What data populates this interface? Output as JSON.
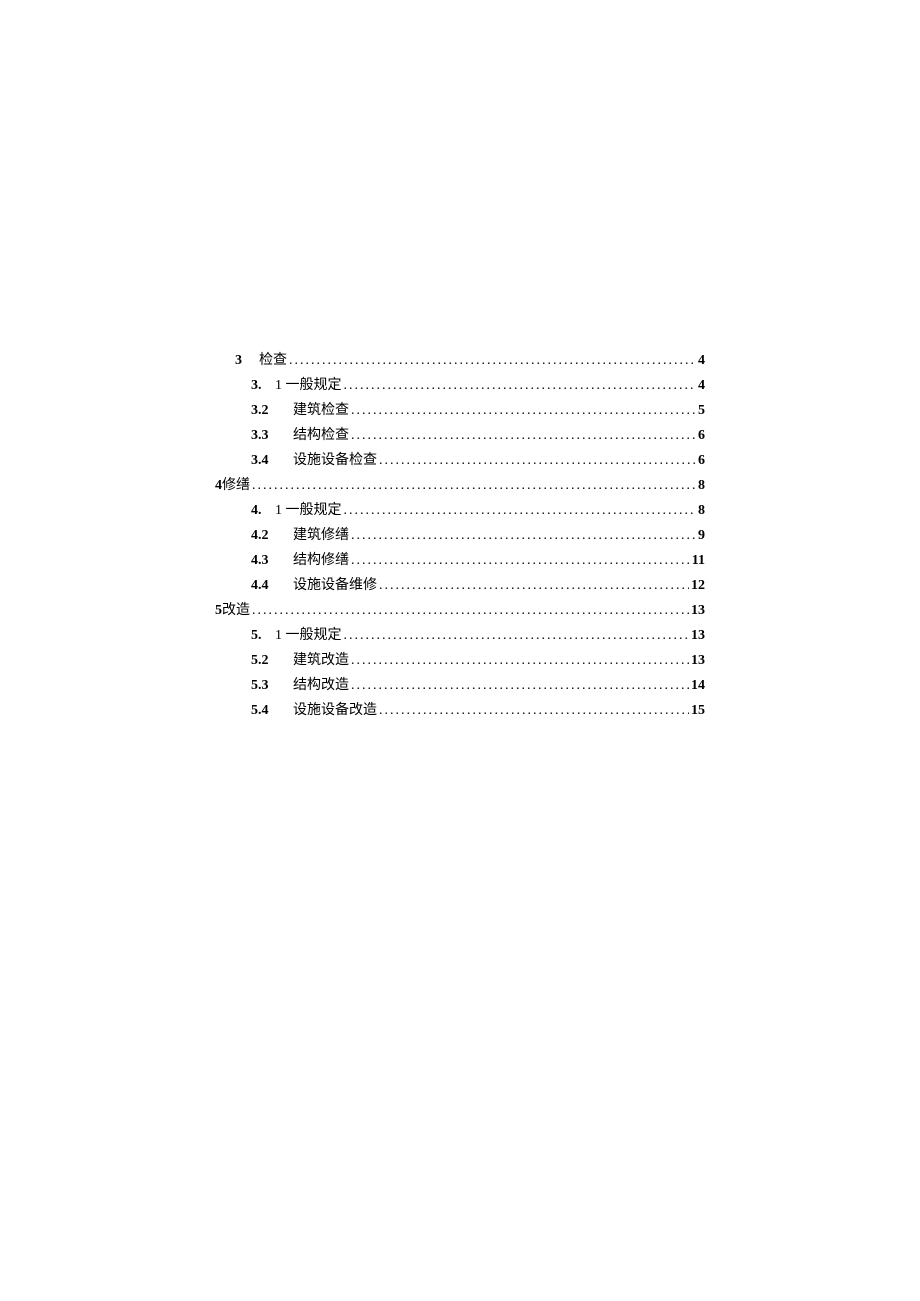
{
  "toc": [
    {
      "level": 1,
      "num": "3",
      "title": "检查",
      "page": "4",
      "numClass": "chapter-num",
      "titleClass": "toc-title"
    },
    {
      "level": 2,
      "num": "3.",
      "title": "1 一般规定",
      "page": "4",
      "numClass": "chapter-num",
      "titleClass": "toc-title"
    },
    {
      "level": 2,
      "num": "3.2",
      "title": "建筑检查",
      "page": "5",
      "numClass": "sub-num",
      "titleClass": "sub-title"
    },
    {
      "level": 2,
      "num": "3.3",
      "title": "结构检查",
      "page": "6",
      "numClass": "sub-num",
      "titleClass": "sub-title"
    },
    {
      "level": 2,
      "num": "3.4",
      "title": "设施设备检查",
      "page": "6",
      "numClass": "sub-num",
      "titleClass": "sub-title"
    },
    {
      "level": 0,
      "num": "4",
      "title": "修缮",
      "page": "8",
      "numClass": "",
      "titleClass": ""
    },
    {
      "level": 2,
      "num": "4.",
      "title": "1 一般规定",
      "page": "8",
      "numClass": "chapter-num",
      "titleClass": "toc-title"
    },
    {
      "level": 2,
      "num": "4.2",
      "title": "建筑修缮",
      "page": "9",
      "numClass": "sub-num",
      "titleClass": "sub-title"
    },
    {
      "level": 2,
      "num": "4.3",
      "title": "结构修缮",
      "page": "11",
      "numClass": "sub-num",
      "titleClass": "sub-title"
    },
    {
      "level": 2,
      "num": "4.4",
      "title": "设施设备维修",
      "page": "12",
      "numClass": "sub-num",
      "titleClass": "sub-title"
    },
    {
      "level": 0,
      "num": "5",
      "title": "改造",
      "page": "13",
      "numClass": "",
      "titleClass": ""
    },
    {
      "level": 2,
      "num": "5.",
      "title": "1 一般规定",
      "page": "13",
      "numClass": "chapter-num",
      "titleClass": "toc-title"
    },
    {
      "level": 2,
      "num": "5.2",
      "title": "建筑改造",
      "page": "13",
      "numClass": "sub-num",
      "titleClass": "sub-title"
    },
    {
      "level": 2,
      "num": "5.3",
      "title": "结构改造",
      "page": "14",
      "numClass": "sub-num",
      "titleClass": "sub-title"
    },
    {
      "level": 2,
      "num": "5.4",
      "title": "设施设备改造",
      "page": "15",
      "numClass": "sub-num",
      "titleClass": "sub-title"
    }
  ],
  "dots": "........................................................................................................................"
}
